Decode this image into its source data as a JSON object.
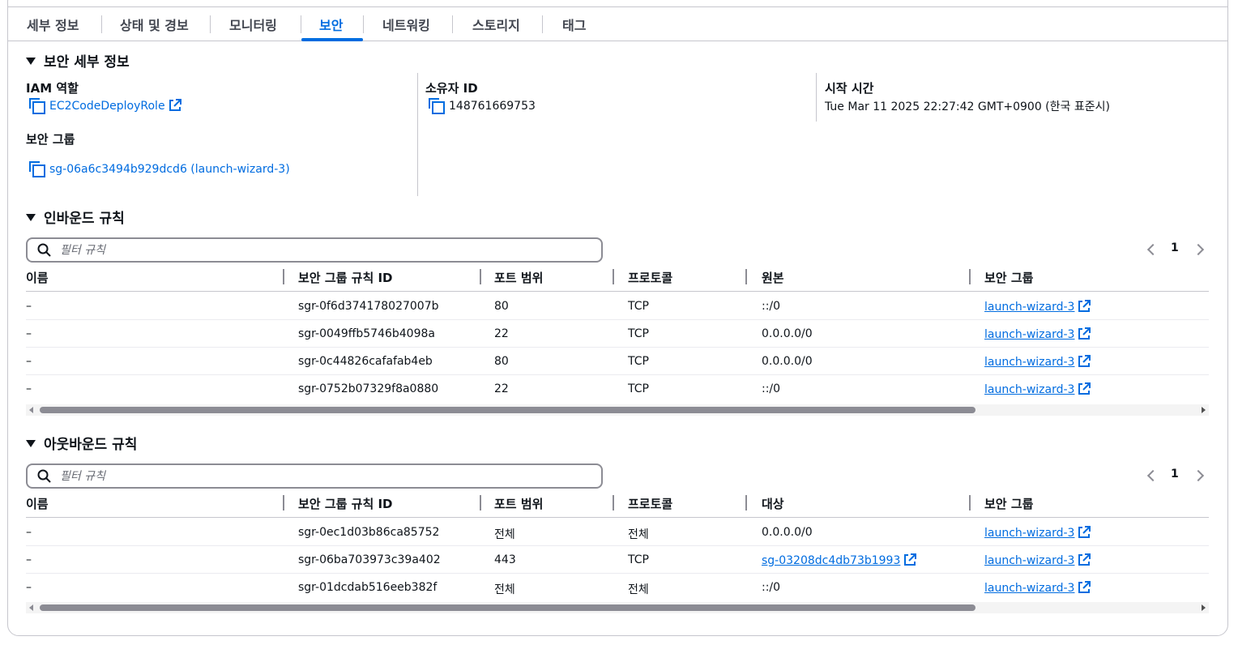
{
  "tabs": [
    {
      "label": "세부 정보"
    },
    {
      "label": "상태 및 경보"
    },
    {
      "label": "모니터링"
    },
    {
      "label": "보안"
    },
    {
      "label": "네트워킹"
    },
    {
      "label": "스토리지"
    },
    {
      "label": "태그"
    }
  ],
  "active_tab": "보안",
  "details": {
    "title": "보안 세부 정보",
    "iam_role_label": "IAM 역할",
    "iam_role_value": "EC2CodeDeployRole",
    "security_group_label": "보안 그룹",
    "security_group_value": "sg-06a6c3494b929dcd6 (launch-wizard-3)",
    "owner_id_label": "소유자 ID",
    "owner_id_value": "148761669753",
    "launch_time_label": "시작 시간",
    "launch_time_value": "Tue Mar 11 2025 22:27:42 GMT+0900 (한국 표준시)"
  },
  "inbound": {
    "title": "인바운드 규칙",
    "filter_placeholder": "필터 규칙",
    "page": "1",
    "columns": [
      "이름",
      "보안 그룹 규칙 ID",
      "포트 범위",
      "프로토콜",
      "원본",
      "보안 그룹"
    ],
    "rows": [
      {
        "name": "–",
        "rule_id": "sgr-0f6d374178027007b",
        "port": "80",
        "protocol": "TCP",
        "source": "::/0",
        "sg": "launch-wizard-3"
      },
      {
        "name": "–",
        "rule_id": "sgr-0049ffb5746b4098a",
        "port": "22",
        "protocol": "TCP",
        "source": "0.0.0.0/0",
        "sg": "launch-wizard-3"
      },
      {
        "name": "–",
        "rule_id": "sgr-0c44826cafafab4eb",
        "port": "80",
        "protocol": "TCP",
        "source": "0.0.0.0/0",
        "sg": "launch-wizard-3"
      },
      {
        "name": "–",
        "rule_id": "sgr-0752b07329f8a0880",
        "port": "22",
        "protocol": "TCP",
        "source": "::/0",
        "sg": "launch-wizard-3"
      }
    ]
  },
  "outbound": {
    "title": "아웃바운드 규칙",
    "filter_placeholder": "필터 규칙",
    "page": "1",
    "columns": [
      "이름",
      "보안 그룹 규칙 ID",
      "포트 범위",
      "프로토콜",
      "대상",
      "보안 그룹"
    ],
    "rows": [
      {
        "name": "–",
        "rule_id": "sgr-0ec1d03b86ca85752",
        "port": "전체",
        "protocol": "전체",
        "dest": "0.0.0.0/0",
        "sg": "launch-wizard-3"
      },
      {
        "name": "–",
        "rule_id": "sgr-06ba703973c39a402",
        "port": "443",
        "protocol": "TCP",
        "dest": "sg-03208dc4db73b1993",
        "sg": "launch-wizard-3"
      },
      {
        "name": "–",
        "rule_id": "sgr-01dcdab516eeb382f",
        "port": "전체",
        "protocol": "전체",
        "dest": "::/0",
        "sg": "launch-wizard-3"
      }
    ]
  },
  "colors": {
    "accent": "#006ce0",
    "text": "#0f141a",
    "border": "#c6c6cd"
  }
}
